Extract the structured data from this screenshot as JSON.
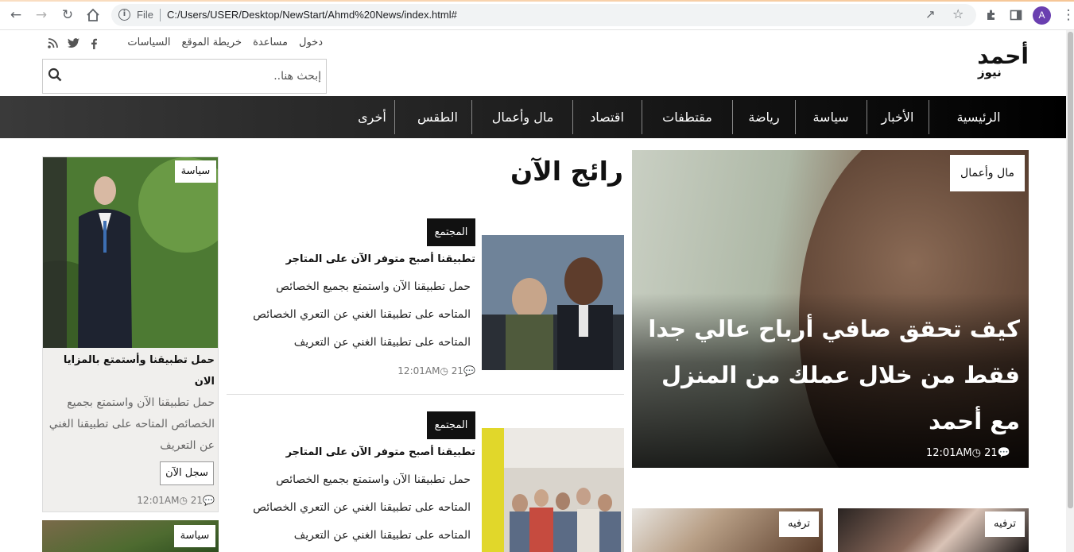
{
  "browser": {
    "file_label": "File",
    "url": "C:/Users/USER/Desktop/NewStart/Ahmd%20News/index.html#",
    "avatar_letter": "A"
  },
  "site": {
    "logo_main": "أحمد",
    "logo_sub": "نيوز",
    "top_links": [
      "دخول",
      "مساعدة",
      "خريطة الموقع",
      "السياسات"
    ],
    "social_icons": [
      "facebook-icon",
      "twitter-icon",
      "rss-icon"
    ],
    "search_placeholder": "إبحث هنا.."
  },
  "nav": {
    "items": [
      "الرئيسية",
      "الأخبار",
      "سياسة",
      "رياضة",
      "مقتطفات",
      "اقتصاد",
      "مال وأعمال",
      "الطقس",
      "أخرى"
    ]
  },
  "hero": {
    "tag": "مال وأعمال",
    "title": "كيف تحقق صافي أرباح عالي جدا فقط من خلال عملك من المنزل مع أحمد",
    "comments": "21",
    "time": "12:01AM"
  },
  "trending": {
    "title": "رائج الآن",
    "articles": [
      {
        "tag": "المجتمع",
        "title": "تطبيقنا أصبح متوفر الآن على المتاجر",
        "lines": [
          "حمل تطبيقنا الآن واستمتع بجميع الخصائص",
          "المتاحه على تطبيقنا الغني عن التعري الخصائص",
          "المتاحه على تطبيقنا الغني عن التعريف"
        ],
        "comments": "21",
        "time": "12:01AM"
      },
      {
        "tag": "المجتمع",
        "title": "تطبيقنا أصبح متوفر الآن على المتاجر",
        "lines": [
          "حمل تطبيقنا الآن واستمتع بجميع الخصائص",
          "المتاحه على تطبيقنا الغني عن التعري الخصائص",
          "المتاحه على تطبيقنا الغني عن التعريف"
        ]
      }
    ]
  },
  "side_card": {
    "tag": "سياسة",
    "title": "حمل تطبيقنا وأستمتع بالمزايا الان",
    "body": "حمل تطبيقنا الآن واستمتع بجميع الخصائص المتاحه على تطبيقنا الغني عن التعريف",
    "button": "سجل الآن",
    "comments": "21",
    "time": "12:01AM"
  },
  "side_card2": {
    "tag": "سياسة"
  },
  "bottom_cards": [
    {
      "tag": "ترفيه"
    },
    {
      "tag": "ترفيه"
    }
  ]
}
